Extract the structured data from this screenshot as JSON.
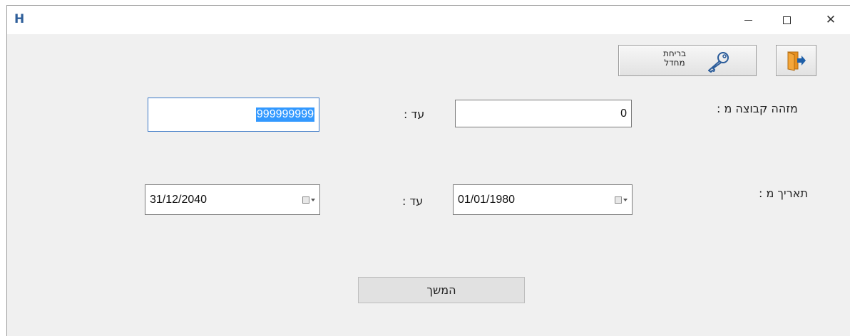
{
  "window": {
    "app_icon": "H",
    "controls": {
      "minimize": "–",
      "maximize": "□",
      "close": "✕"
    }
  },
  "toolbar": {
    "exit_icon": "exit-door-icon",
    "password_change_label": "בריחת מחדל",
    "password_icon": "key-icon"
  },
  "form": {
    "group_id": {
      "label": "מזהה קבוצה מ :",
      "from_value": "0",
      "to_label": "עד :",
      "to_value": "999999999"
    },
    "date": {
      "label": "תאריך מ :",
      "from_value": "01/01/1980",
      "to_label": "עד :",
      "to_value": "31/12/2040"
    }
  },
  "actions": {
    "continue_label": "המשך"
  },
  "colors": {
    "selection": "#3399ff",
    "focus_border": "#3c79c7",
    "background": "#f0f0f0",
    "exit_orange": "#e8901f",
    "arrow_blue": "#1e5fa8"
  }
}
